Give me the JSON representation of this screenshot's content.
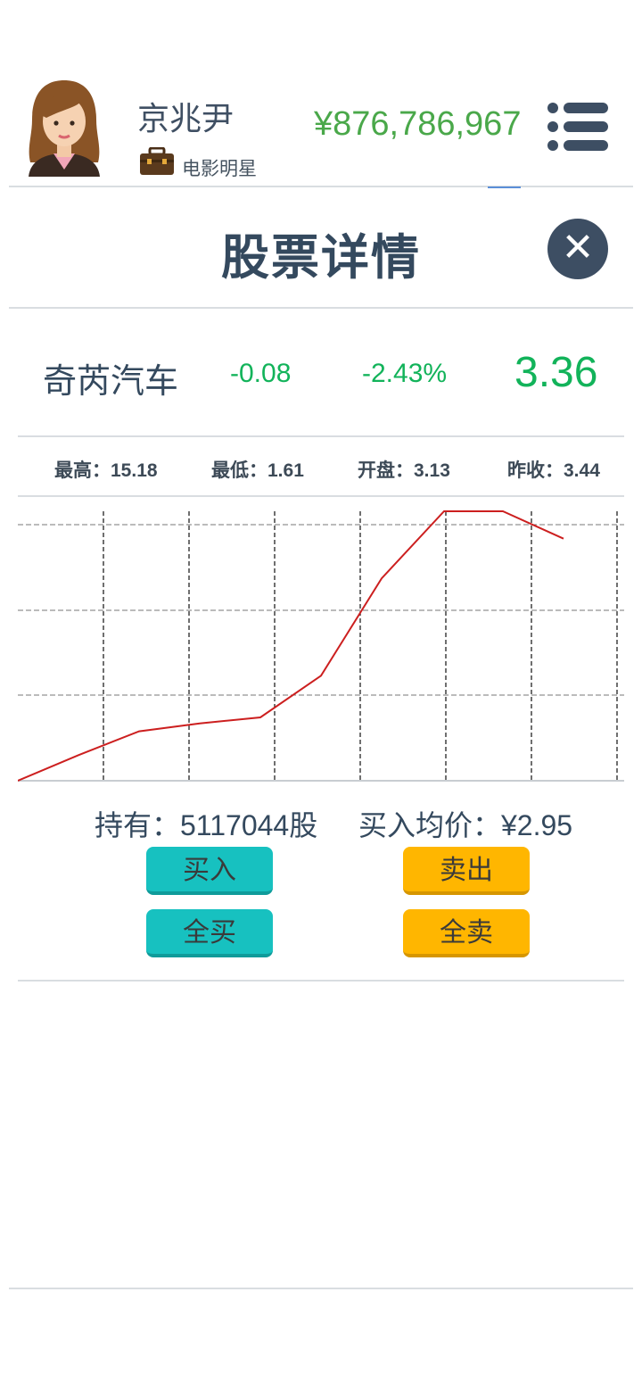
{
  "header": {
    "player_name": "京兆尹",
    "job": "电影明星",
    "money": "¥876,786,967",
    "menu_icon": "menu-icon",
    "job_icon": "briefcase-icon",
    "avatar_icon": "female-avatar-icon"
  },
  "panel": {
    "title": "股票详情",
    "close_icon": "close-icon"
  },
  "stock": {
    "name": "奇芮汽车",
    "change": "-0.08",
    "change_pct": "-2.43%",
    "price": "3.36",
    "price_color": "#12b35a"
  },
  "stats": {
    "high": "最高：15.18",
    "low": "最低：1.61",
    "open": "开盘：3.13",
    "prev_close": "昨收：3.44"
  },
  "chart_data": {
    "type": "line",
    "title": "",
    "xlabel": "",
    "ylabel": "",
    "grid": true,
    "x": [
      0,
      1,
      2,
      3,
      4,
      5,
      6,
      7,
      8,
      9
    ],
    "series": [
      {
        "color": "#cc1f1f",
        "values": [
          1.61,
          2.9,
          4.1,
          4.5,
          4.8,
          6.9,
          11.8,
          15.18,
          15.18,
          13.8
        ]
      }
    ],
    "ylim": [
      1.61,
      15.18
    ]
  },
  "holdings": {
    "held": "持有：5117044股",
    "avg_price": "买入均价：¥2.95"
  },
  "actions": {
    "buy": "买入",
    "sell": "卖出",
    "buy_all": "全买",
    "sell_all": "全卖",
    "buy_color": "#17c1c0",
    "sell_color": "#ffb600"
  }
}
